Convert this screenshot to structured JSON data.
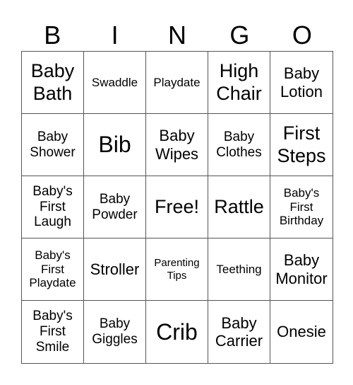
{
  "header": [
    "B",
    "I",
    "N",
    "G",
    "O"
  ],
  "cells": [
    "Baby Bath",
    "Swaddle",
    "Playdate",
    "High Chair",
    "Baby Lotion",
    "Baby Shower",
    "Bib",
    "Baby Wipes",
    "Baby Clothes",
    "First Steps",
    "Baby's First Laugh",
    "Baby Powder",
    "Free!",
    "Rattle",
    "Baby's First Birthday",
    "Baby's First Playdate",
    "Stroller",
    "Parenting Tips",
    "Teething",
    "Baby Monitor",
    "Baby's First Smile",
    "Baby Giggles",
    "Crib",
    "Baby Carrier",
    "Onesie"
  ]
}
